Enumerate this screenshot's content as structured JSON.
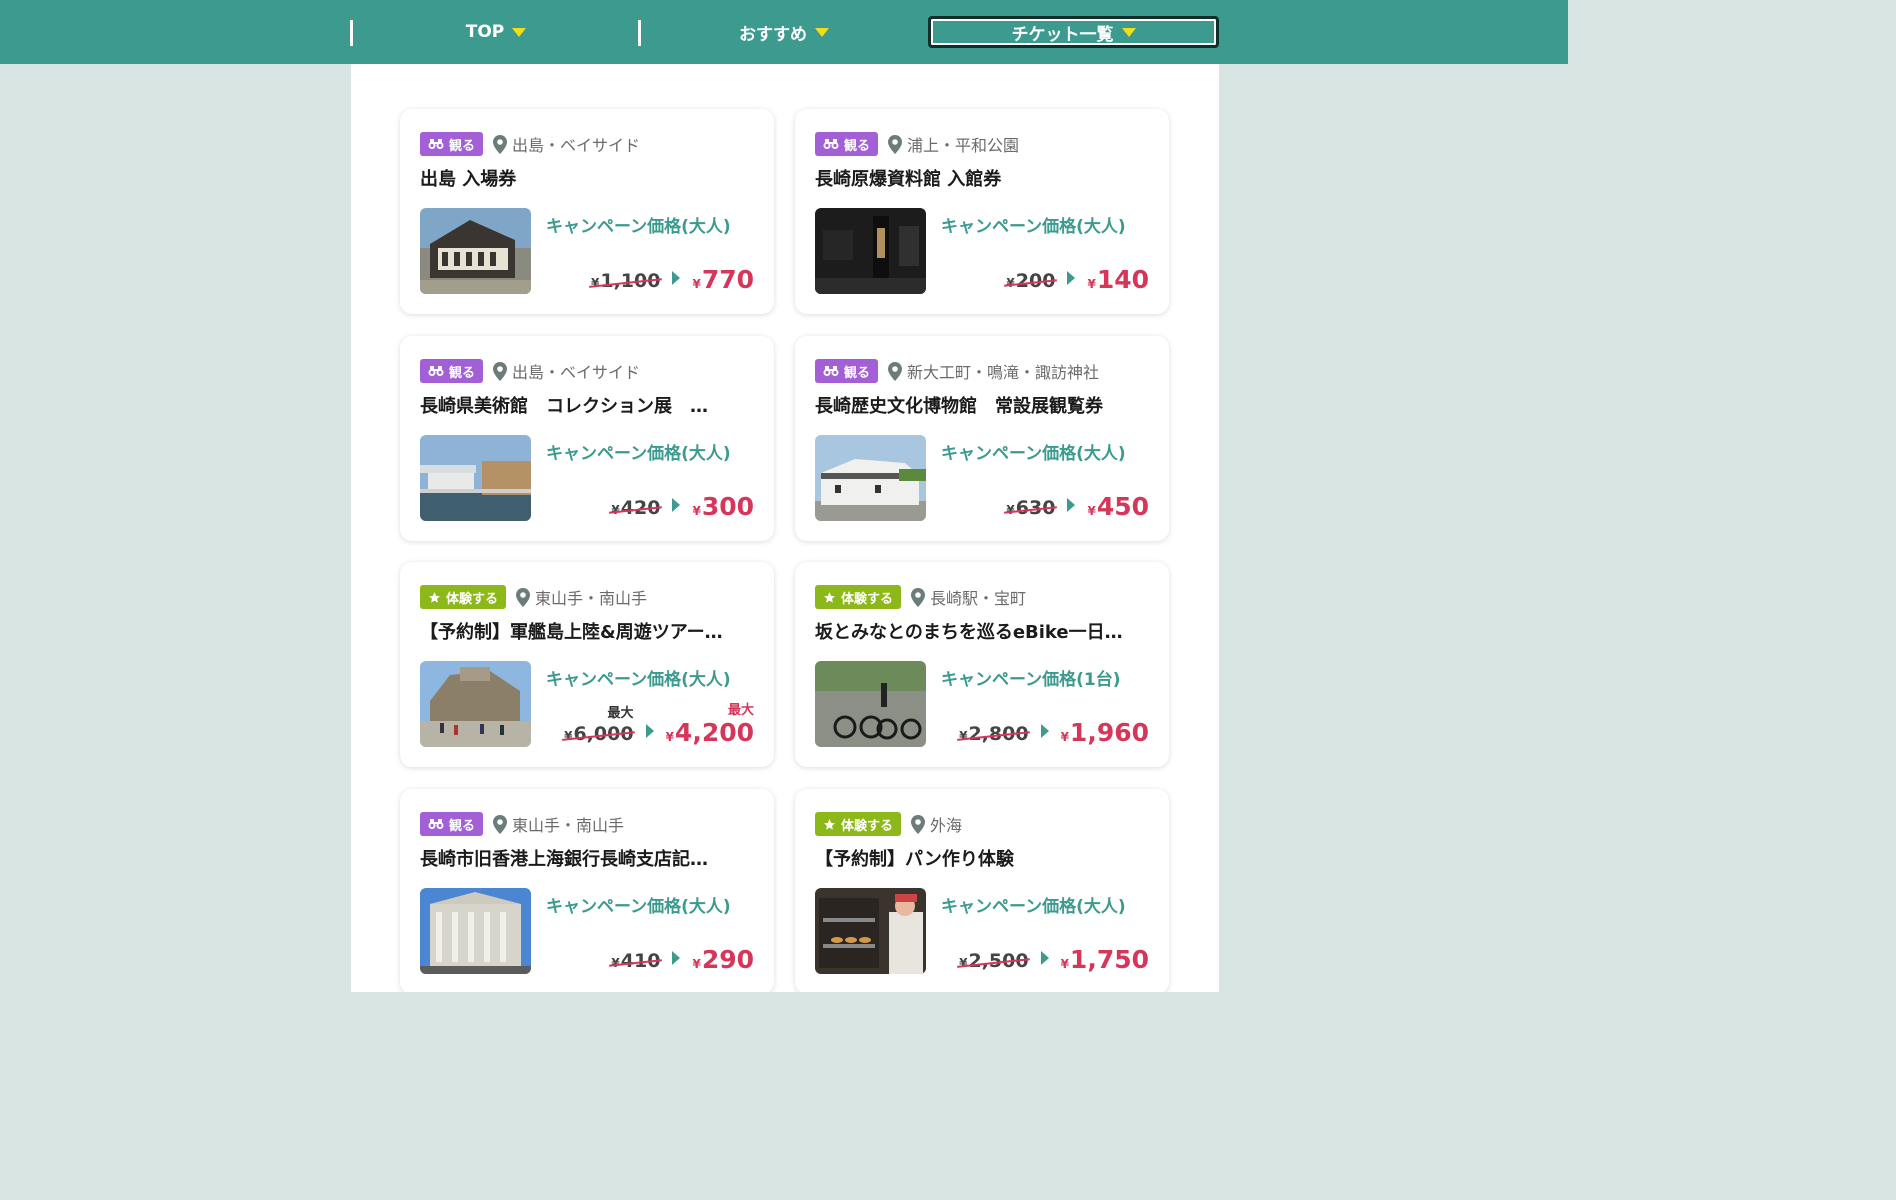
{
  "nav": {
    "items": [
      {
        "label": "TOP"
      },
      {
        "label": "おすすめ"
      },
      {
        "label": "チケット一覧"
      }
    ]
  },
  "colors": {
    "header": "#3c9a8f",
    "accent": "#3c9a8f",
    "price_red": "#d6365a",
    "badge_see": "#a25fd6",
    "badge_experience": "#8cb81a",
    "nav_triangle": "#f0df16"
  },
  "cards": [
    {
      "category": "観る",
      "category_icon": "binoculars-icon",
      "area": "出島・ベイサイド",
      "title": "出島 入場券",
      "price_label": "キャンペーン価格(大人)",
      "currency": "¥",
      "old_price": "1,100",
      "new_price": "770"
    },
    {
      "category": "観る",
      "category_icon": "binoculars-icon",
      "area": "浦上・平和公園",
      "title": "長崎原爆資料館 入館券",
      "price_label": "キャンペーン価格(大人)",
      "currency": "¥",
      "old_price": "200",
      "new_price": "140"
    },
    {
      "category": "観る",
      "category_icon": "binoculars-icon",
      "area": "出島・ベイサイド",
      "title": "長崎県美術館　コレクション展　…",
      "price_label": "キャンペーン価格(大人)",
      "currency": "¥",
      "old_price": "420",
      "new_price": "300"
    },
    {
      "category": "観る",
      "category_icon": "binoculars-icon",
      "area": "新大工町・鳴滝・諏訪神社",
      "title": "長崎歴史文化博物館　常設展観覧券",
      "price_label": "キャンペーン価格(大人)",
      "currency": "¥",
      "old_price": "630",
      "new_price": "450"
    },
    {
      "category": "体験する",
      "category_icon": "star-icon",
      "area": "東山手・南山手",
      "title": "【予約制】軍艦島上陸&周遊ツアー…",
      "price_label": "キャンペーン価格(大人)",
      "currency": "¥",
      "old_price": "6,000",
      "new_price": "4,200",
      "max_label": "最大"
    },
    {
      "category": "体験する",
      "category_icon": "star-icon",
      "area": "長崎駅・宝町",
      "title": "坂とみなとのまちを巡るeBike一日…",
      "price_label": "キャンペーン価格(1台)",
      "currency": "¥",
      "old_price": "2,800",
      "new_price": "1,960"
    },
    {
      "category": "観る",
      "category_icon": "binoculars-icon",
      "area": "東山手・南山手",
      "title": "長崎市旧香港上海銀行長崎支店記…",
      "price_label": "キャンペーン価格(大人)",
      "currency": "¥",
      "old_price": "410",
      "new_price": "290"
    },
    {
      "category": "体験する",
      "category_icon": "star-icon",
      "area": "外海",
      "title": "【予約制】パン作り体験",
      "price_label": "キャンペーン価格(大人)",
      "currency": "¥",
      "old_price": "2,500",
      "new_price": "1,750"
    }
  ]
}
